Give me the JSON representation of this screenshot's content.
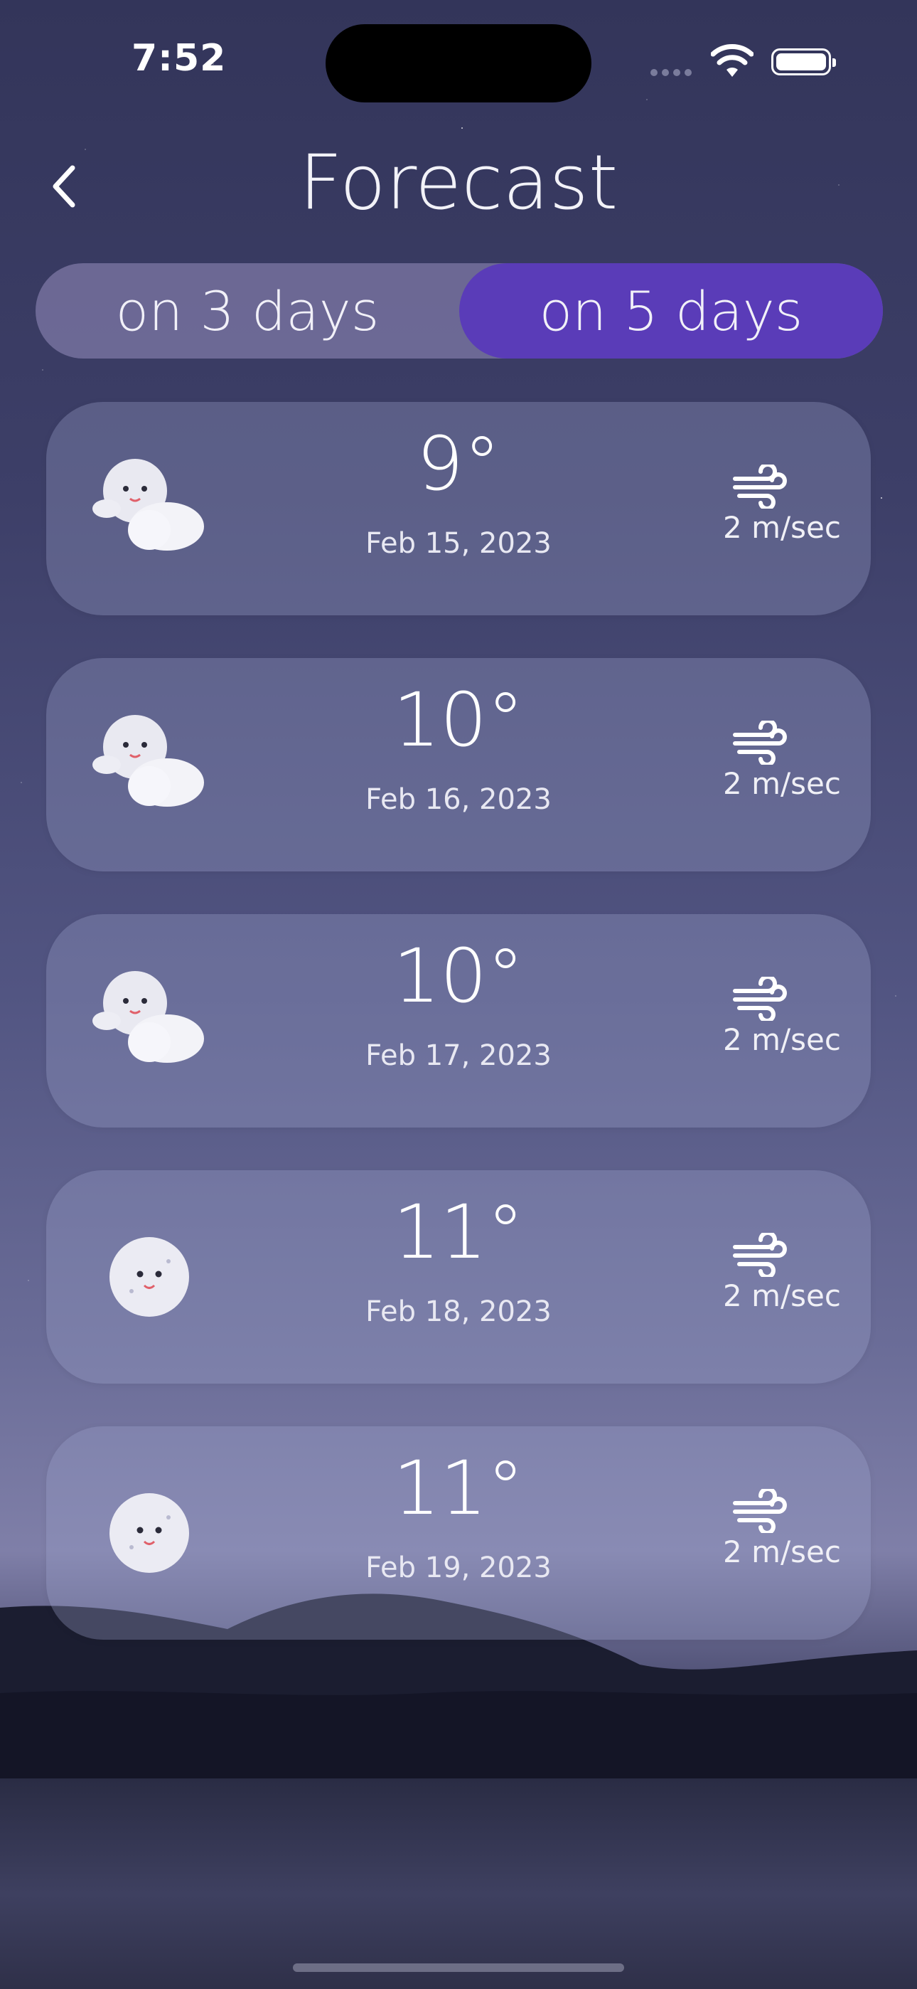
{
  "status_bar": {
    "time": "7:52"
  },
  "header": {
    "title": "Forecast"
  },
  "segmented_control": {
    "options": [
      "on 3 days",
      "on 5 days"
    ],
    "selected": "on 5 days",
    "selected_color": "#5a3cb8"
  },
  "forecast": [
    {
      "temp": "9°",
      "date": "Feb 15, 2023",
      "wind": "2 m/sec",
      "icon": "moon-cloud-icon"
    },
    {
      "temp": "10°",
      "date": "Feb 16, 2023",
      "wind": "2 m/sec",
      "icon": "moon-cloud-icon"
    },
    {
      "temp": "10°",
      "date": "Feb 17, 2023",
      "wind": "2 m/sec",
      "icon": "moon-cloud-icon"
    },
    {
      "temp": "11°",
      "date": "Feb 18, 2023",
      "wind": "2 m/sec",
      "icon": "moon-icon"
    },
    {
      "temp": "11°",
      "date": "Feb 19, 2023",
      "wind": "2 m/sec",
      "icon": "moon-icon"
    }
  ]
}
